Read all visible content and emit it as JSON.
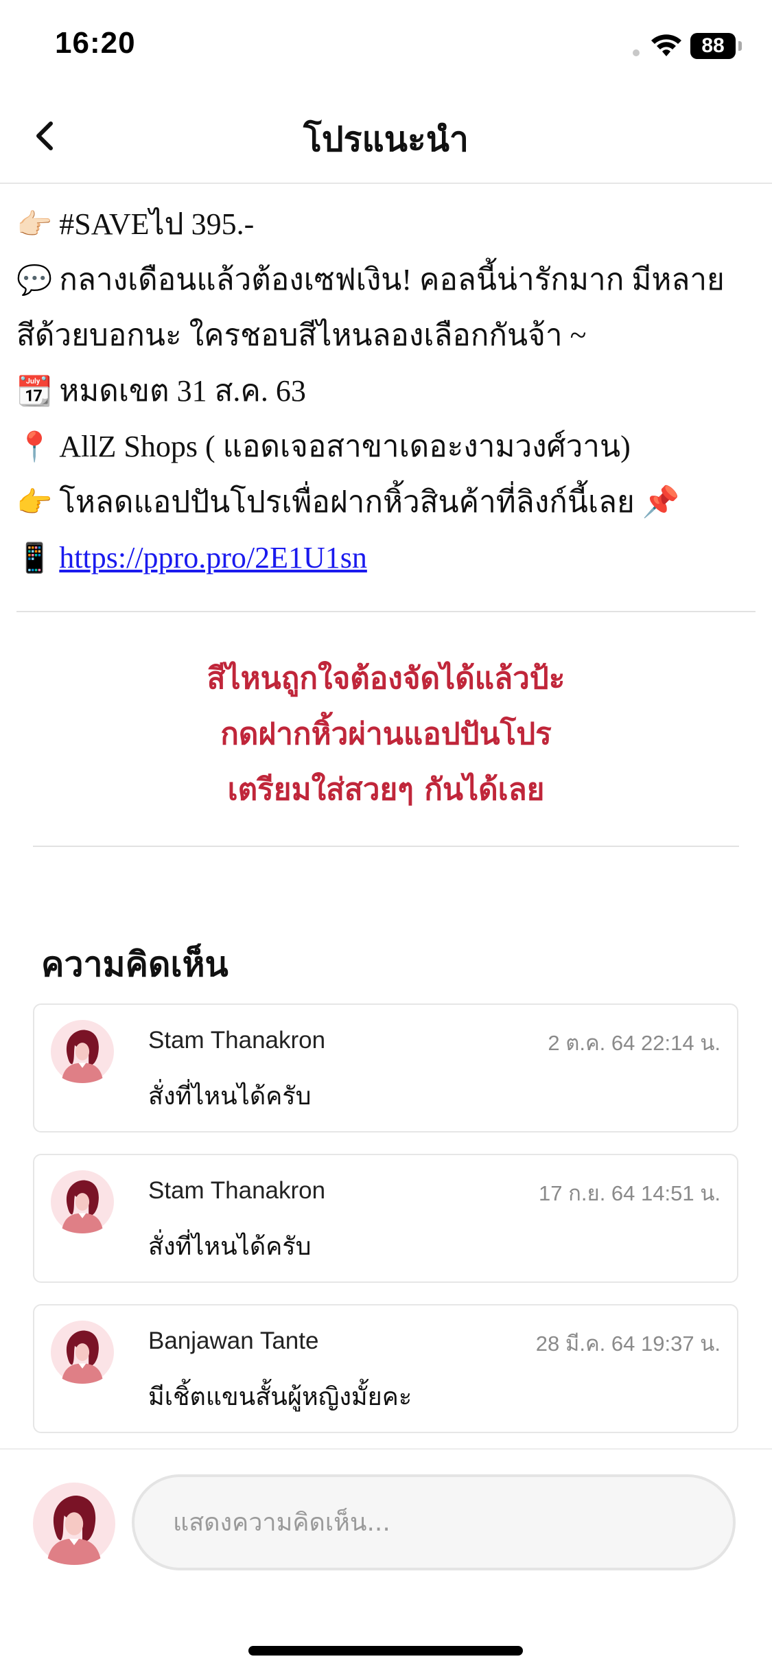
{
  "status_bar": {
    "time": "16:20",
    "battery": "88"
  },
  "nav": {
    "title": "โปรแนะนำ"
  },
  "post": {
    "lines": [
      {
        "emoji": "👉🏻",
        "text": "#SAVEไป 395.-"
      },
      {
        "emoji": "💬",
        "text": "กลางเดือนแล้วต้องเซฟเงิน! คอลนี้น่ารักมาก มีหลาย"
      },
      {
        "emoji": "",
        "text": "สีด้วยบอกนะ ใครชอบสีไหนลองเลือกกันจ้า ~"
      },
      {
        "emoji": "📆",
        "text": "หมดเขต 31 ส.ค. 63"
      },
      {
        "emoji": "📍",
        "text": "AllZ Shops ( แอดเจอสาขาเดอะงามวงศ์วาน)"
      },
      {
        "emoji": "👉",
        "text": "โหลดแอปปันโปรเพื่อฝากหิ้วสินค้าที่ลิงก์นี้เลย 📌"
      },
      {
        "emoji": "📱",
        "link": "https://ppro.pro/2E1U1sn"
      }
    ]
  },
  "promo": {
    "lines": [
      "สีไหนถูกใจต้องจัดได้แล้วป้ะ",
      "กดฝากหิ้วผ่านแอปปันโปร",
      "เตรียมใส่สวยๆ กันได้เลย"
    ],
    "color": "#c0263a"
  },
  "comments": {
    "title": "ความคิดเห็น",
    "items": [
      {
        "name": "Stam Thanakron",
        "date": "2 ต.ค. 64 22:14 น.",
        "text": "สั่งที่ไหนได้ครับ"
      },
      {
        "name": "Stam Thanakron",
        "date": "17 ก.ย. 64 14:51 น.",
        "text": "สั่งที่ไหนได้ครับ"
      },
      {
        "name": "Banjawan Tante",
        "date": "28 มี.ค. 64 19:37 น.",
        "text": "มีเชิ้ตแขนสั้นผู้หญิงมั้ยคะ"
      }
    ]
  },
  "input": {
    "placeholder": "แสดงความคิดเห็น..."
  }
}
